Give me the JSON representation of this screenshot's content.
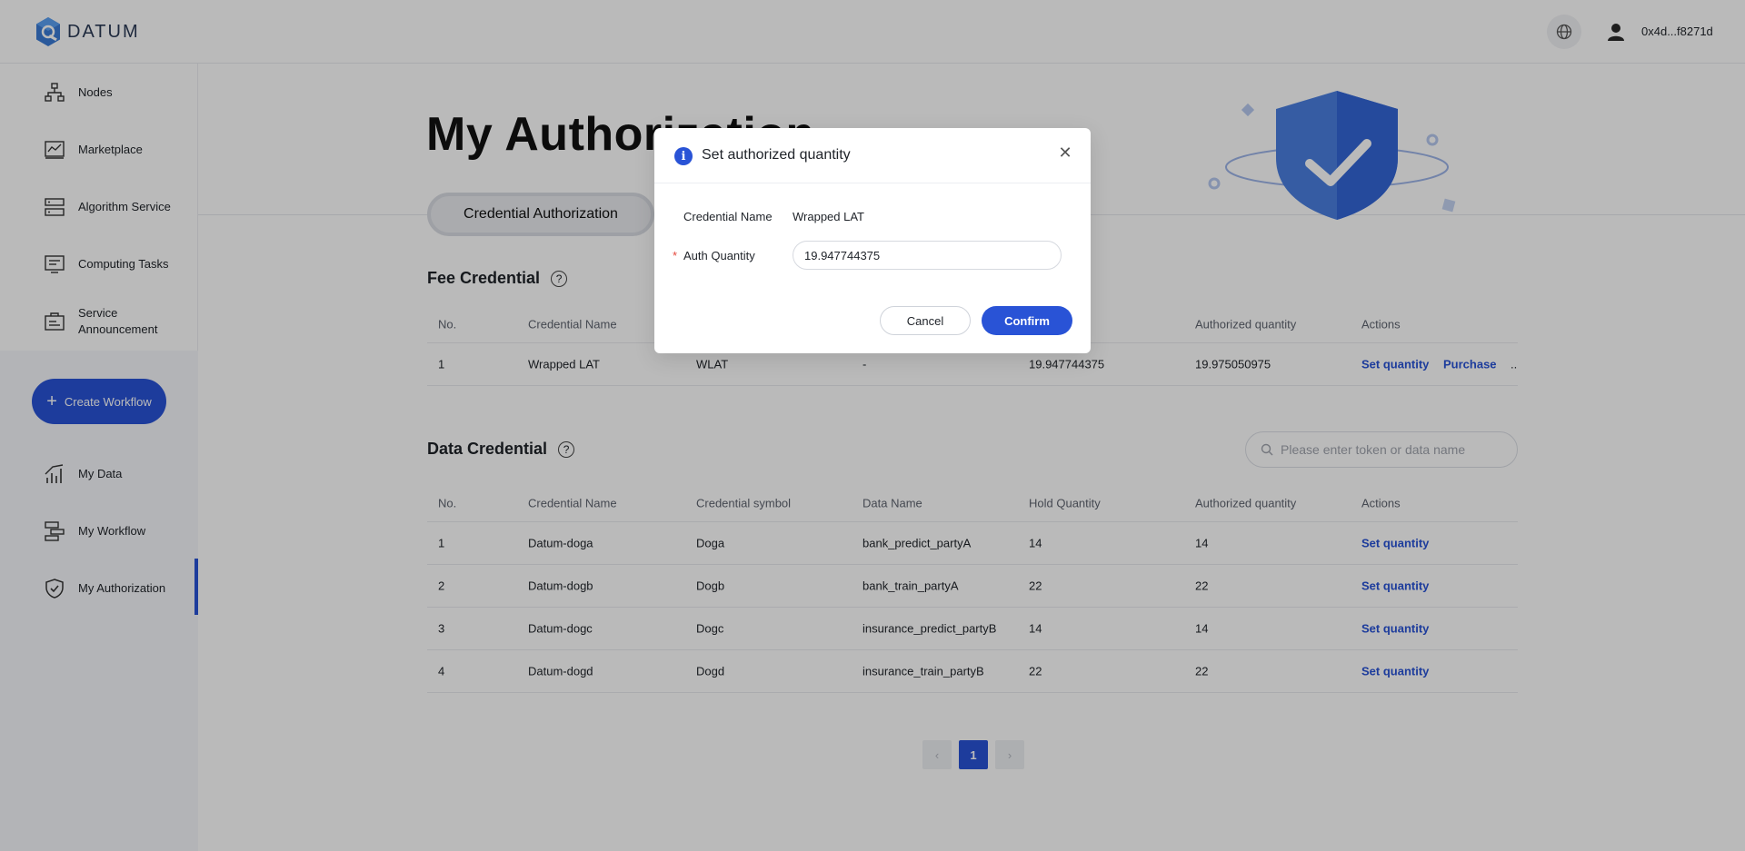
{
  "app": {
    "brand": "DATUM"
  },
  "header": {
    "user_address": "0x4d...f8271d"
  },
  "sidebar": {
    "items": [
      {
        "label": "Nodes",
        "icon": "nodes-icon"
      },
      {
        "label": "Marketplace",
        "icon": "marketplace-icon"
      },
      {
        "label": "Algorithm Service",
        "icon": "algorithm-icon"
      },
      {
        "label": "Computing Tasks",
        "icon": "computing-icon"
      },
      {
        "label": "Service Announcement",
        "icon": "announcement-icon"
      }
    ],
    "create_label": "Create Workflow",
    "items_lower": [
      {
        "label": "My Data",
        "icon": "chart-icon"
      },
      {
        "label": "My Workflow",
        "icon": "workflow-icon"
      },
      {
        "label": "My Authorization",
        "icon": "shield-check-icon",
        "active": true
      }
    ]
  },
  "main": {
    "title": "My Authorization",
    "tab_label": "Credential Authorization",
    "fee_section": {
      "title": "Fee Credential",
      "headers": [
        "No.",
        "Credential Name",
        "",
        "",
        "",
        "Authorized quantity",
        "Actions"
      ],
      "header_hold_partial": "ity",
      "rows": [
        {
          "no": "1",
          "name": "Wrapped LAT",
          "symbol": "WLAT",
          "data": "-",
          "hold": "19.947744375",
          "auth": "19.975050975",
          "action1": "Set quantity",
          "action2": "Purchase",
          "more": ".."
        }
      ]
    },
    "data_section": {
      "title": "Data Credential",
      "search_placeholder": "Please enter token or data name",
      "headers": [
        "No.",
        "Credential Name",
        "Credential symbol",
        "Data Name",
        "Hold Quantity",
        "Authorized quantity",
        "Actions"
      ],
      "rows": [
        {
          "no": "1",
          "name": "Datum-doga",
          "symbol": "Doga",
          "data": "bank_predict_partyA",
          "hold": "14",
          "auth": "14",
          "action": "Set quantity"
        },
        {
          "no": "2",
          "name": "Datum-dogb",
          "symbol": "Dogb",
          "data": "bank_train_partyA",
          "hold": "22",
          "auth": "22",
          "action": "Set quantity"
        },
        {
          "no": "3",
          "name": "Datum-dogc",
          "symbol": "Dogc",
          "data": "insurance_predict_partyB",
          "hold": "14",
          "auth": "14",
          "action": "Set quantity"
        },
        {
          "no": "4",
          "name": "Datum-dogd",
          "symbol": "Dogd",
          "data": "insurance_train_partyB",
          "hold": "22",
          "auth": "22",
          "action": "Set quantity"
        }
      ]
    },
    "pagination": {
      "prev": "‹",
      "current": "1",
      "next": "›"
    }
  },
  "modal": {
    "title": "Set authorized quantity",
    "credential_name_label": "Credential Name",
    "credential_name_value": "Wrapped LAT",
    "auth_quantity_label": "Auth Quantity",
    "required_mark": "*",
    "auth_quantity_value": "19.947744375",
    "cancel_label": "Cancel",
    "confirm_label": "Confirm"
  },
  "colors": {
    "primary": "#2953d6",
    "overlay": "rgba(0,0,0,0.27)"
  }
}
